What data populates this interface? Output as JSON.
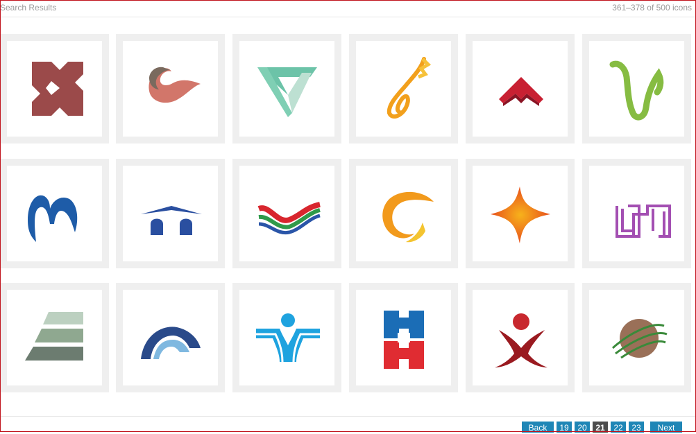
{
  "header": {
    "title": "Search Results",
    "count": "361–378 of 500 icons"
  },
  "icons": [
    {
      "name": "red-x-logo-icon"
    },
    {
      "name": "swoosh-wave-logo-icon"
    },
    {
      "name": "teal-triangle-logo-icon"
    },
    {
      "name": "yellow-flame-logo-icon"
    },
    {
      "name": "red-arrow-logo-icon"
    },
    {
      "name": "green-w-logo-icon"
    },
    {
      "name": "blue-m-logo-icon"
    },
    {
      "name": "blue-bridge-logo-icon"
    },
    {
      "name": "ribbon-waves-logo-icon"
    },
    {
      "name": "orange-swirl-logo-icon"
    },
    {
      "name": "orange-star-logo-icon"
    },
    {
      "name": "purple-maze-logo-icon"
    },
    {
      "name": "green-stack-logo-icon"
    },
    {
      "name": "blue-arch-logo-icon"
    },
    {
      "name": "blue-person-logo-icon"
    },
    {
      "name": "red-blue-m-logo-icon"
    },
    {
      "name": "red-figure-logo-icon"
    },
    {
      "name": "brown-globe-logo-icon"
    }
  ],
  "pagination": {
    "back": "Back",
    "pages": [
      "19",
      "20",
      "21",
      "22",
      "23"
    ],
    "current": "21",
    "next": "Next"
  },
  "colors": {
    "accent": "#1f86b6",
    "current_page": "#4d4d4d",
    "tile_border": "#efefef",
    "frame": "#c0121b"
  }
}
